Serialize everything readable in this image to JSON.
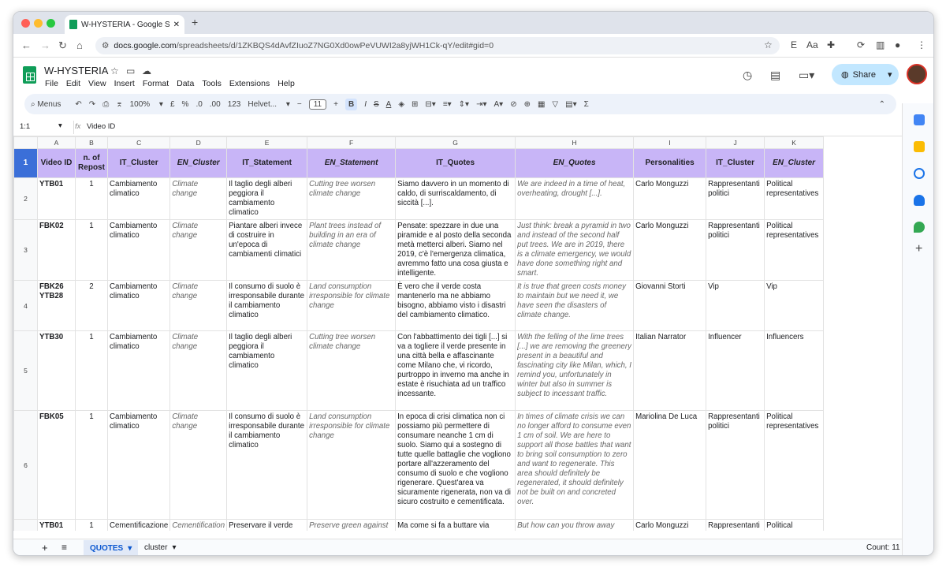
{
  "browser": {
    "tab_title": "W-HYSTERIA - Google Sheets",
    "url_host": "docs.google.com",
    "url_path": "/spreadsheets/d/1ZKBQS4dAvfZIuoZ7NG0Xd0owPeVUWI2a8yjWH1Ck-qY/edit#gid=0"
  },
  "doc": {
    "title": "W-HYSTERIA",
    "menus": [
      "File",
      "Edit",
      "View",
      "Insert",
      "Format",
      "Data",
      "Tools",
      "Extensions",
      "Help"
    ],
    "share_label": "Share"
  },
  "toolbar": {
    "menus_label": "Menus",
    "zoom": "100%",
    "currency": "£",
    "percent": "%",
    "dec_minus": ".0",
    "dec_plus": ".00",
    "num_format": "123",
    "font": "Helvet...",
    "font_size": "11"
  },
  "formula": {
    "cell_ref": "1:1",
    "fx": "fx",
    "content": "Video ID"
  },
  "columns": [
    "A",
    "B",
    "C",
    "D",
    "E",
    "F",
    "G",
    "H",
    "I",
    "J",
    "K"
  ],
  "header": {
    "row_num": "1",
    "cells": [
      "Video ID",
      "n. of Repost",
      "IT_Cluster",
      "EN_Cluster",
      "IT_Statement",
      "EN_Statement",
      "IT_Quotes",
      "EN_Quotes",
      "Personalities",
      "IT_Cluster",
      "EN_Cluster"
    ]
  },
  "rows": [
    {
      "n": "2",
      "cells": [
        "YTB01",
        "1",
        "Cambiamento climatico",
        "Climate change",
        "Il taglio degli alberi peggiora il cambiamento climatico",
        "Cutting tree worsen climate change",
        "Siamo davvero in un momento di caldo, di surriscaldamento, di siccità [...].",
        "We are indeed in a time of heat, overheating, drought [...].",
        "Carlo Monguzzi",
        "Rappresentanti politici",
        "Political representatives"
      ]
    },
    {
      "n": "3",
      "cells": [
        "FBK02",
        "1",
        "Cambiamento climatico",
        "Climate change",
        "Piantare alberi invece di costruire in un'epoca di cambiamenti climatici",
        "Plant trees instead of building in an era of climate change",
        "Pensate: spezzare in due una piramide e al posto della seconda metà metterci alberi. Siamo nel 2019, c'è l'emergenza climatica, avremmo fatto una cosa giusta e intelligente.",
        "Just think: break a pyramid in two and instead of the second half put trees. We are in 2019, there is a climate emergency, we would have done something right and smart.",
        "Carlo Monguzzi",
        "Rappresentanti politici",
        "Political representatives"
      ]
    },
    {
      "n": "4",
      "cells": [
        "FBK26 YTB28",
        "2",
        "Cambiamento climatico",
        "Climate change",
        "Il consumo di suolo è irresponsabile durante il cambiamento climatico",
        "Land consumption irresponsible for climate change",
        "È vero che il verde costa mantenerlo ma ne abbiamo bisogno, abbiamo visto i disastri del cambiamento climatico.",
        "It is true that green costs money to maintain but we need it, we have seen the disasters of climate change.",
        "Giovanni Storti",
        "Vip",
        "Vip"
      ]
    },
    {
      "n": "5",
      "cells": [
        "YTB30",
        "1",
        "Cambiamento climatico",
        "Climate change",
        "Il taglio degli alberi peggiora il cambiamento climatico",
        "Cutting tree worsen climate change",
        "Con l'abbattimento dei tigli [...] si va a togliere il verde presente in una città bella e affascinante come Milano che, vi ricordo, purtroppo in inverno ma anche in estate è risuchiata ad un traffico incessante.",
        "With the felling of the lime trees [...] we are removing the greenery present in a beautiful and fascinating city like Milan, which, I remind you, unfortunately in winter but also in summer is subject to incessant traffic.",
        "Italian Narrator",
        "Influencer",
        "Influencers"
      ]
    },
    {
      "n": "6",
      "cells": [
        "FBK05",
        "1",
        "Cambiamento climatico",
        "Climate change",
        "Il consumo di suolo è irresponsabile durante il cambiamento climatico",
        "Land consumption irresponsible for climate change",
        "In epoca di crisi climatica non ci possiamo più permettere di consumare neanche 1 cm di suolo. Siamo qui a sostegno di tutte quelle battaglie che vogliono portare all'azzeramento del consumo di suolo e che vogliono rigenerare. Quest'area va sicuramente rigenerata, non va di sicuro costruito e cementificata.",
        "In times of climate crisis we can no longer afford to consume even 1 cm of soil. We are here to support all those battles that want to bring soil consumption to zero and want to regenerate. This area should definitely be regenerated, it should definitely not be built on and concreted over.",
        "Mariolina De Luca",
        "Rappresentanti politici",
        "Political representatives"
      ]
    },
    {
      "n": "7",
      "cells": [
        "YTB01",
        "1",
        "Cementificazione",
        "Cementification",
        "Preservare il verde",
        "Preserve green against",
        "Ma come si fa a buttare via",
        "But how can you throw away",
        "Carlo Monguzzi",
        "Rappresentanti politici",
        "Political"
      ]
    }
  ],
  "sheets": [
    "QUOTES",
    "cluster"
  ],
  "status": {
    "count": "Count: 11"
  },
  "colors": {
    "header_bg": "#c8b5f7",
    "accent": "#0b57d0"
  }
}
